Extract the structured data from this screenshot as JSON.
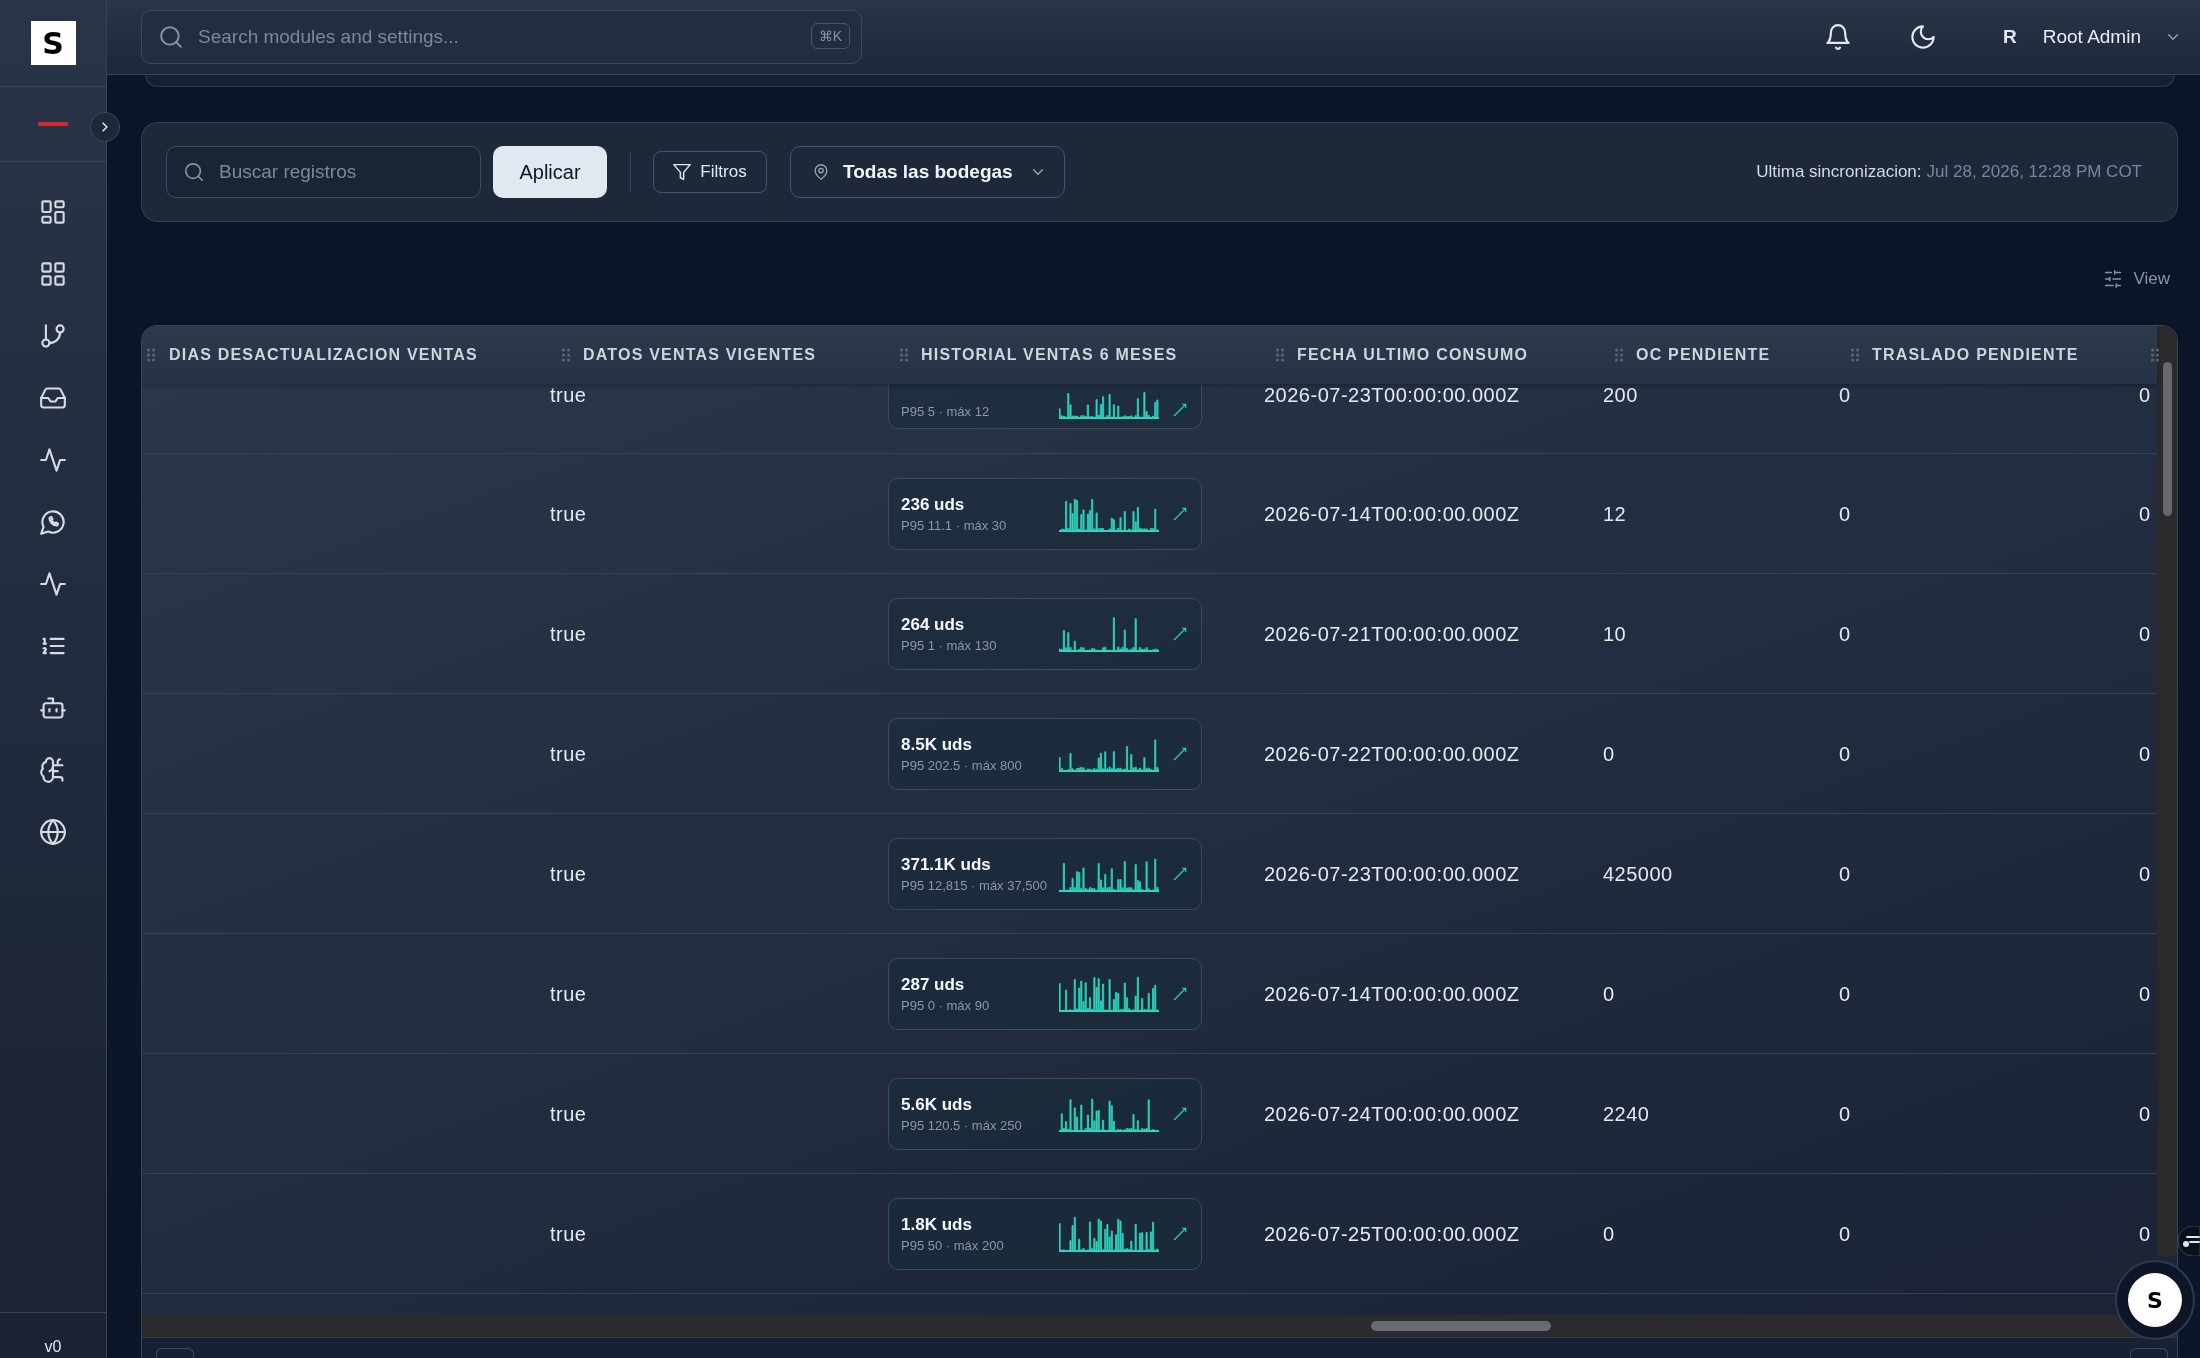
{
  "sidebar": {
    "logo": "S",
    "version": "v0"
  },
  "topbar": {
    "search": {
      "placeholder": "Search modules and settings...",
      "shortcut": "⌘K"
    },
    "user": {
      "initial": "R",
      "name": "Root Admin"
    }
  },
  "filters": {
    "search": {
      "placeholder": "Buscar registros"
    },
    "apply_button": "Aplicar",
    "filters_button": "Filtros",
    "warehouse_select": {
      "value": "Todas las bodegas"
    },
    "last_sync": {
      "label": "Ultima sincronizacion:",
      "value": "Jul 28, 2026, 12:28 PM COT"
    }
  },
  "view_button": "View",
  "table": {
    "columns": [
      "DIAS DESACTUALIZACION VENTAS",
      "DATOS VENTAS VIGENTES",
      "HISTORIAL VENTAS 6 MESES",
      "FECHA ULTIMO CONSUMO",
      "OC PENDIENTE",
      "TRASLADO PENDIENTE"
    ],
    "rows": [
      {
        "datos_ventas_vigentes": "true",
        "historial_ventas_6_meses": {
          "stats": "P95 5 · máx 12"
        },
        "fecha_ultimo_consumo": "2026-07-23T00:00:00.000Z",
        "oc_pendiente": "200",
        "traslado_pendiente": "0",
        "column_7": "0"
      },
      {
        "datos_ventas_vigentes": "true",
        "historial_ventas_6_meses": {
          "total": "236 uds",
          "stats": "P95 11.1 · máx 30"
        },
        "fecha_ultimo_consumo": "2026-07-14T00:00:00.000Z",
        "oc_pendiente": "12",
        "traslado_pendiente": "0",
        "column_7": "0"
      },
      {
        "datos_ventas_vigentes": "true",
        "historial_ventas_6_meses": {
          "total": "264 uds",
          "stats": "P95 1 · máx 130"
        },
        "fecha_ultimo_consumo": "2026-07-21T00:00:00.000Z",
        "oc_pendiente": "10",
        "traslado_pendiente": "0",
        "column_7": "0"
      },
      {
        "datos_ventas_vigentes": "true",
        "historial_ventas_6_meses": {
          "total": "8.5K uds",
          "stats": "P95 202.5 · máx 800"
        },
        "fecha_ultimo_consumo": "2026-07-22T00:00:00.000Z",
        "oc_pendiente": "0",
        "traslado_pendiente": "0",
        "column_7": "0"
      },
      {
        "datos_ventas_vigentes": "true",
        "historial_ventas_6_meses": {
          "total": "371.1K uds",
          "stats": "P95 12,815 · máx 37,500"
        },
        "fecha_ultimo_consumo": "2026-07-23T00:00:00.000Z",
        "oc_pendiente": "425000",
        "traslado_pendiente": "0",
        "column_7": "0"
      },
      {
        "datos_ventas_vigentes": "true",
        "historial_ventas_6_meses": {
          "total": "287 uds",
          "stats": "P95 0 · máx 90"
        },
        "fecha_ultimo_consumo": "2026-07-14T00:00:00.000Z",
        "oc_pendiente": "0",
        "traslado_pendiente": "0",
        "column_7": "0"
      },
      {
        "datos_ventas_vigentes": "true",
        "historial_ventas_6_meses": {
          "total": "5.6K uds",
          "stats": "P95 120.5 · máx 250"
        },
        "fecha_ultimo_consumo": "2026-07-24T00:00:00.000Z",
        "oc_pendiente": "2240",
        "traslado_pendiente": "0",
        "column_7": "0"
      },
      {
        "datos_ventas_vigentes": "true",
        "historial_ventas_6_meses": {
          "total": "1.8K uds",
          "stats": "P95 50 · máx 200"
        },
        "fecha_ultimo_consumo": "2026-07-25T00:00:00.000Z",
        "oc_pendiente": "0",
        "traslado_pendiente": "0",
        "column_7": "0"
      }
    ]
  },
  "assistant_button": {
    "label": "S"
  }
}
